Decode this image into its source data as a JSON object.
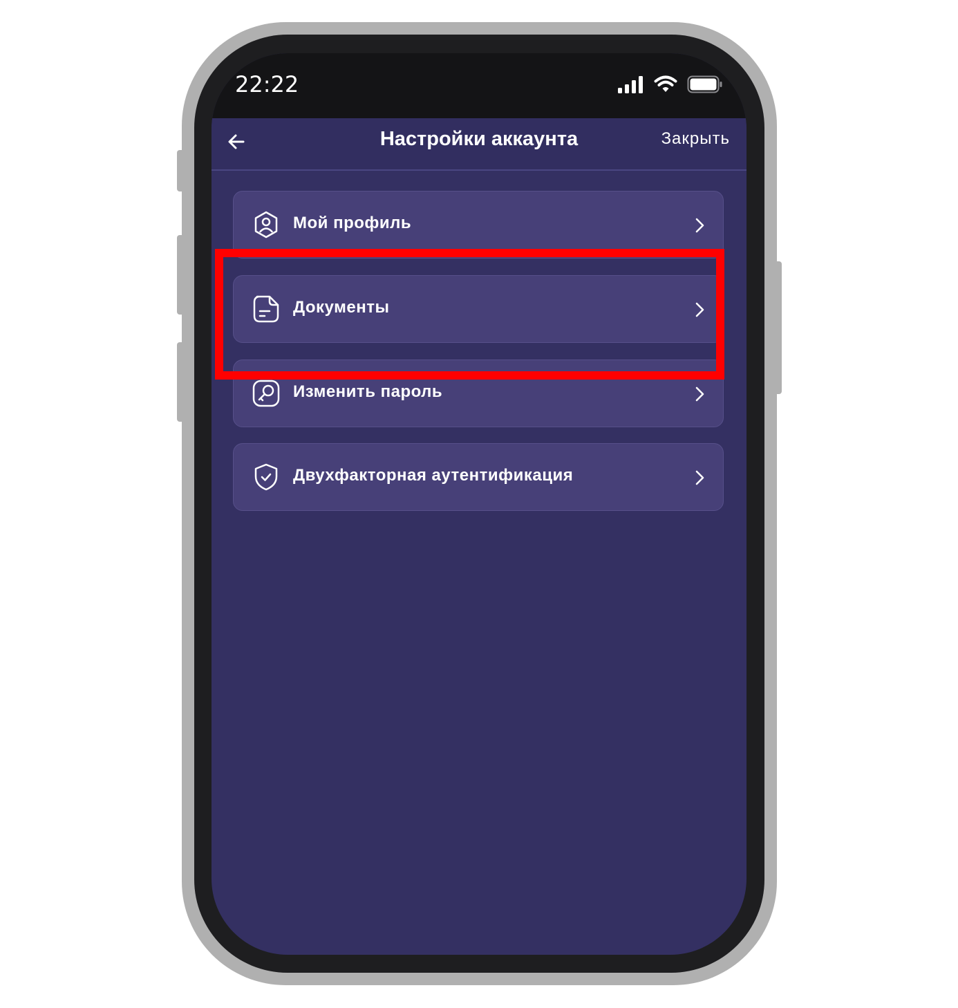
{
  "status_bar": {
    "time": "22:22"
  },
  "nav": {
    "title": "Настройки аккаунта",
    "close_label": "Закрыть"
  },
  "menu": {
    "items": [
      {
        "label": "Мой профиль",
        "icon": "profile-icon"
      },
      {
        "label": "Документы",
        "icon": "document-icon"
      },
      {
        "label": "Изменить пароль",
        "icon": "key-icon"
      },
      {
        "label": "Двухфакторная аутентификация",
        "icon": "shield-check-icon"
      }
    ]
  },
  "colors": {
    "screen_bg": "#343062",
    "item_bg": "#474078",
    "highlight": "#ff0000"
  }
}
